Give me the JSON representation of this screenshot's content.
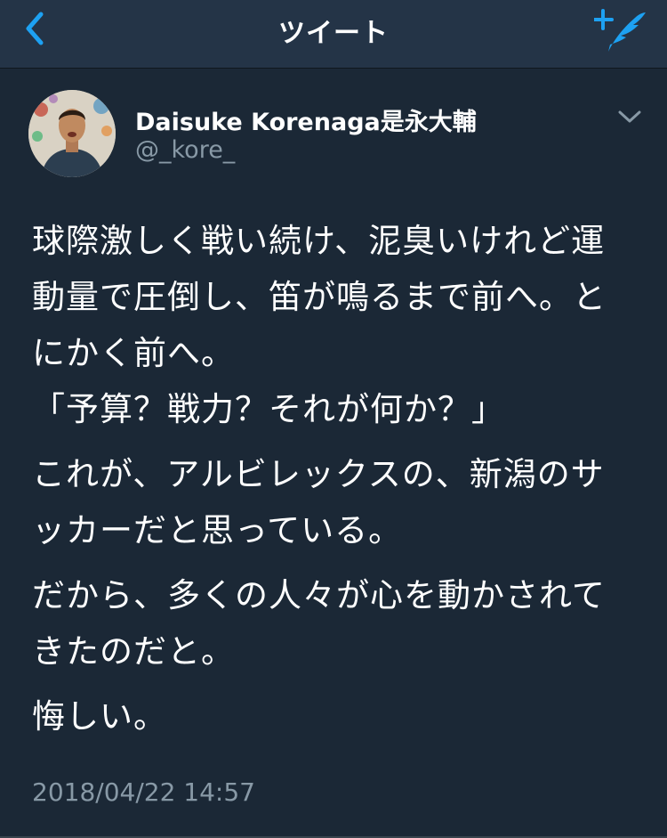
{
  "header": {
    "title": "ツイート",
    "back_icon": "chevron-left-icon",
    "compose_icon": "compose-tweet-icon",
    "accent": "#1da1f2"
  },
  "tweet": {
    "display_name": "Daisuke Korenaga是永大輔",
    "handle": "@_kore_",
    "paragraphs": [
      "球際激しく戦い続け、泥臭いけれど運動量で圧倒し、笛が鳴るまで前へ。とにかく前へ。\n「予算？戦力？それが何か？」",
      "これが、アルビレックスの、新潟のサッカーだと思っている。",
      "だから、多くの人々が心を動かされてきたのだと。",
      "悔しい。"
    ],
    "timestamp": "2018/04/22 14:57"
  }
}
